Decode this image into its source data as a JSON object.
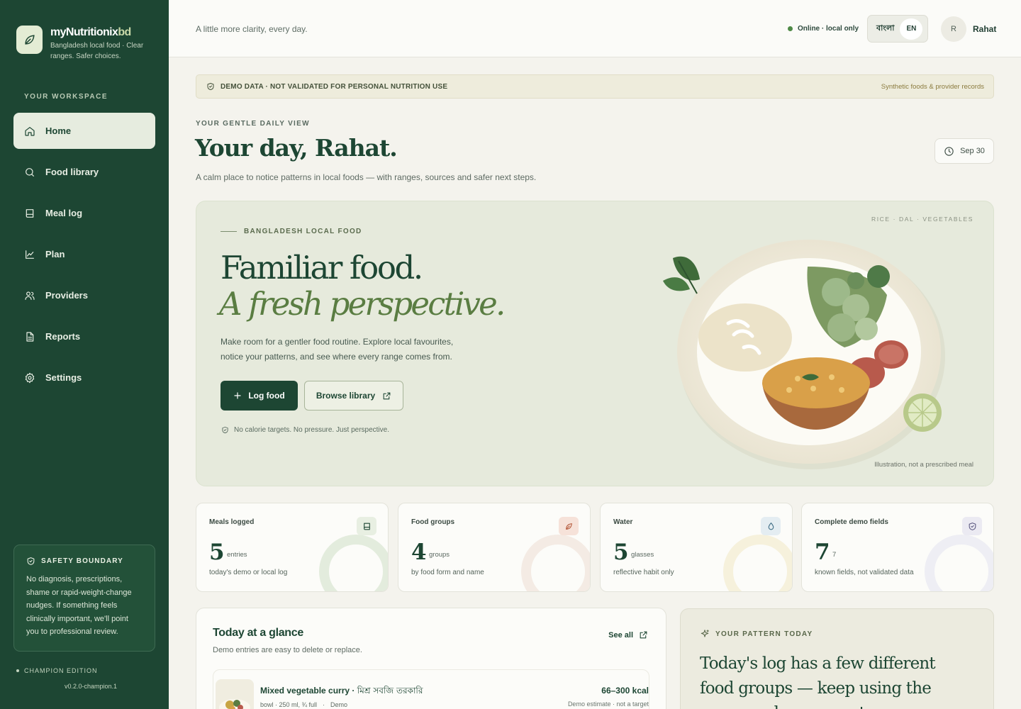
{
  "brand": {
    "name_main": "myNutritionix",
    "name_accent": "bd",
    "tagline": "Bangladesh local food · Clear ranges. Safer choices."
  },
  "sidebar": {
    "section_label": "YOUR WORKSPACE",
    "items": [
      {
        "label": "Home",
        "icon": "home-icon",
        "active": true
      },
      {
        "label": "Food library",
        "icon": "search-icon"
      },
      {
        "label": "Meal log",
        "icon": "book-icon"
      },
      {
        "label": "Plan",
        "icon": "chart-line-icon"
      },
      {
        "label": "Providers",
        "icon": "users-icon"
      },
      {
        "label": "Reports",
        "icon": "document-icon"
      },
      {
        "label": "Settings",
        "icon": "gear-icon"
      }
    ],
    "safety": {
      "title": "SAFETY BOUNDARY",
      "text": "No diagnosis, prescriptions, shame or rapid-weight-change nudges. If something feels clinically important, we'll point you to professional review."
    },
    "edition": "CHAMPION EDITION",
    "version": "v0.2.0-champion.1"
  },
  "header": {
    "tagline": "A little more clarity, every day.",
    "status": "Online · local only",
    "lang_bn": "বাংলা",
    "lang_en": "EN",
    "user_initial": "R",
    "user_name": "Rahat"
  },
  "banner": {
    "left": "DEMO DATA · NOT VALIDATED FOR PERSONAL NUTRITION USE",
    "right": "Synthetic foods & provider records"
  },
  "page": {
    "eyebrow": "YOUR GENTLE DAILY VIEW",
    "title": "Your day, Rahat.",
    "subtitle": "A calm place to notice patterns in local foods — with ranges, sources and safer next steps.",
    "date": "Sep 30"
  },
  "hero": {
    "eyebrow": "BANGLADESH LOCAL FOOD",
    "headline_1": "Familiar food.",
    "headline_2": "A fresh perspective.",
    "text": "Make room for a gentler food routine. Explore local favourites, notice your patterns, and see where every range comes from.",
    "primary_button": "Log food",
    "secondary_button": "Browse library",
    "note": "No calorie targets. No pressure. Just perspective.",
    "tags": "RICE · DAL · VEGETABLES",
    "caption": "Illustration, not a prescribed meal"
  },
  "stats": [
    {
      "label": "Meals logged",
      "value": "5",
      "unit": "entries",
      "sub": "today's demo or local log",
      "icon": "book-icon",
      "color": "#e3ecdd",
      "icon_bg": "#e8efe2"
    },
    {
      "label": "Food groups",
      "value": "4",
      "unit": "groups",
      "sub": "by food form and name",
      "icon": "leaf-icon",
      "color": "#f4ebe4",
      "icon_bg": "#f6e2d9"
    },
    {
      "label": "Water",
      "value": "5",
      "unit": "glasses",
      "sub": "reflective habit only",
      "icon": "droplet-icon",
      "color": "#f6f1dc",
      "icon_bg": "#e4edf2"
    },
    {
      "label": "Complete demo fields",
      "value": "7",
      "unit": "7",
      "sub": "known fields, not validated data",
      "icon": "shield-icon",
      "color": "#eeeef4",
      "icon_bg": "#ebeaf2"
    }
  ],
  "glance": {
    "title": "Today at a glance",
    "subtitle": "Demo entries are easy to delete or replace.",
    "see_all": "See all",
    "meal": {
      "name": "Mixed vegetable curry · ",
      "name_bn": "মিশ্র সবজি তরকারি",
      "portion": "bowl · 250 ml, ¾ full",
      "sep": "·",
      "tag": "Demo",
      "kcal": "66–300 kcal",
      "note": "Demo estimate · not a target"
    }
  },
  "pattern": {
    "label": "YOUR PATTERN TODAY",
    "text": "Today's log has a few different food groups — keep using the range and source notes."
  }
}
